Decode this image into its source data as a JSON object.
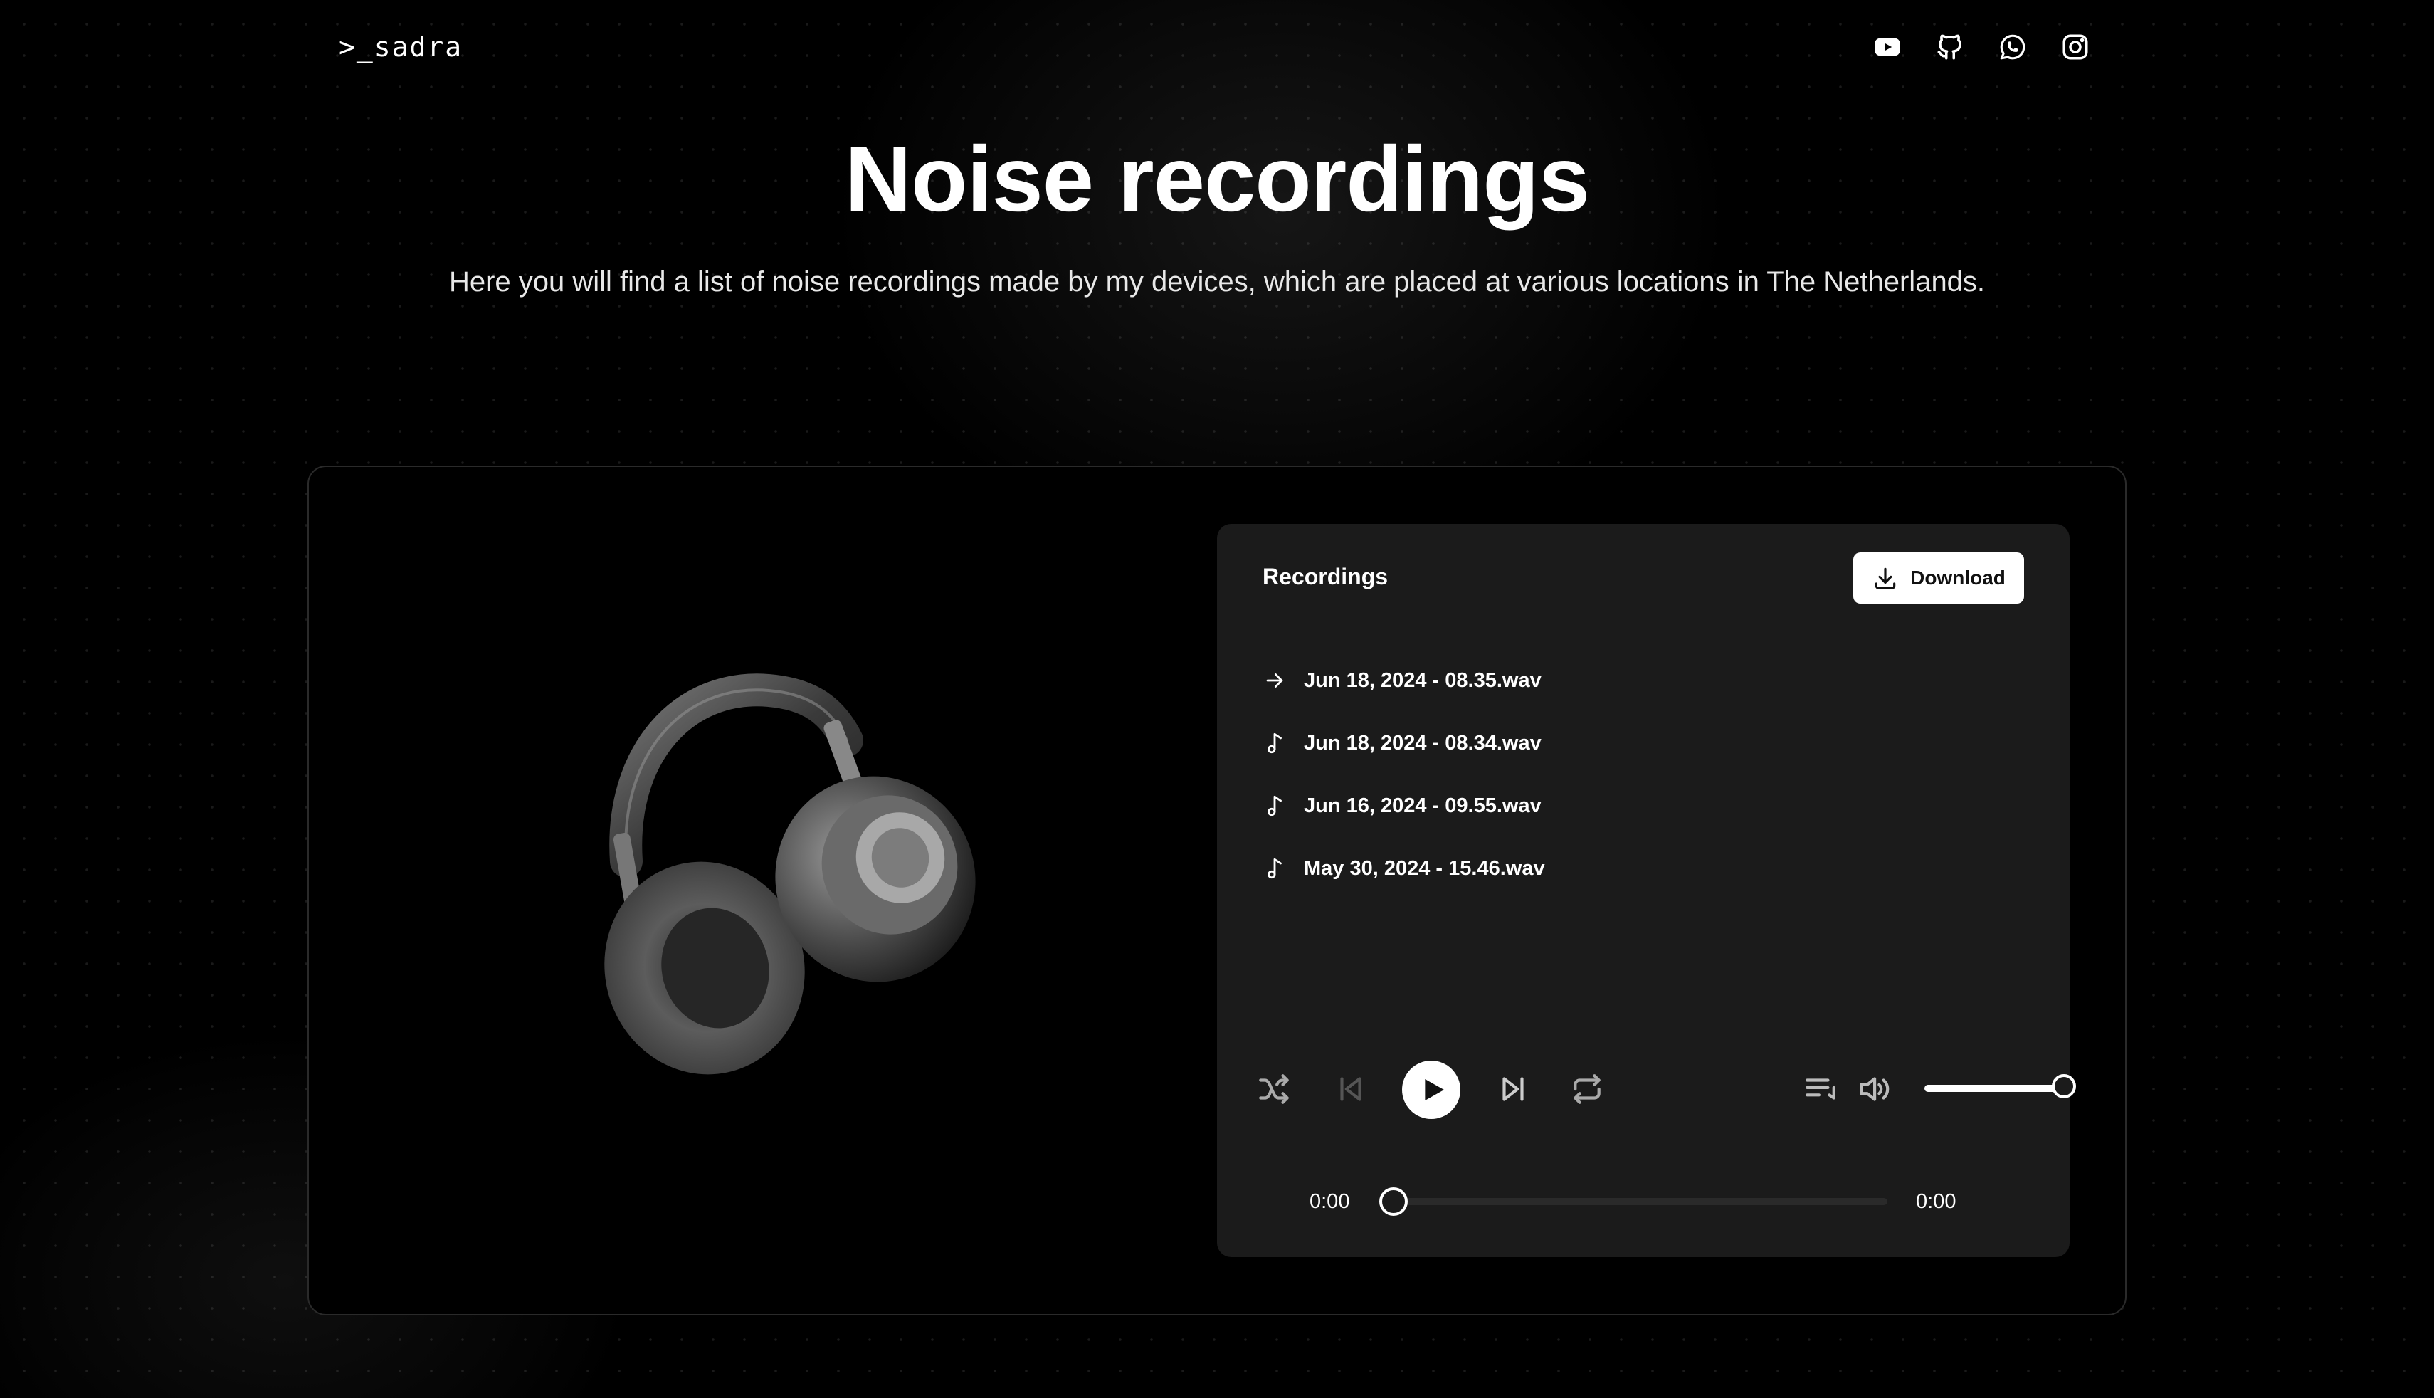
{
  "header": {
    "logo": ">_sadra",
    "socials": [
      {
        "icon": "youtube-icon"
      },
      {
        "icon": "github-icon"
      },
      {
        "icon": "whatsapp-icon"
      },
      {
        "icon": "instagram-icon"
      }
    ]
  },
  "hero": {
    "title": "Noise recordings",
    "subtitle": "Here you will find a list of noise recordings made by my devices, which are placed at various locations in The Netherlands."
  },
  "player": {
    "title": "Recordings",
    "download_label": "Download",
    "recordings": [
      {
        "name": "Jun 18, 2024 - 08.35.wav",
        "icon": "arrow-right-icon",
        "current": true
      },
      {
        "name": "Jun 18, 2024 - 08.34.wav",
        "icon": "music-note-icon",
        "current": false
      },
      {
        "name": "Jun 16, 2024 - 09.55.wav",
        "icon": "music-note-icon",
        "current": false
      },
      {
        "name": "May 30, 2024 - 15.46.wav",
        "icon": "music-note-icon",
        "current": false
      }
    ],
    "current_time": "0:00",
    "duration": "0:00",
    "seek_fraction": 0.0,
    "volume_fraction": 1.0
  },
  "colors": {
    "background": "#000000",
    "panel": "#1b1b1b",
    "accent": "#ffffff"
  }
}
